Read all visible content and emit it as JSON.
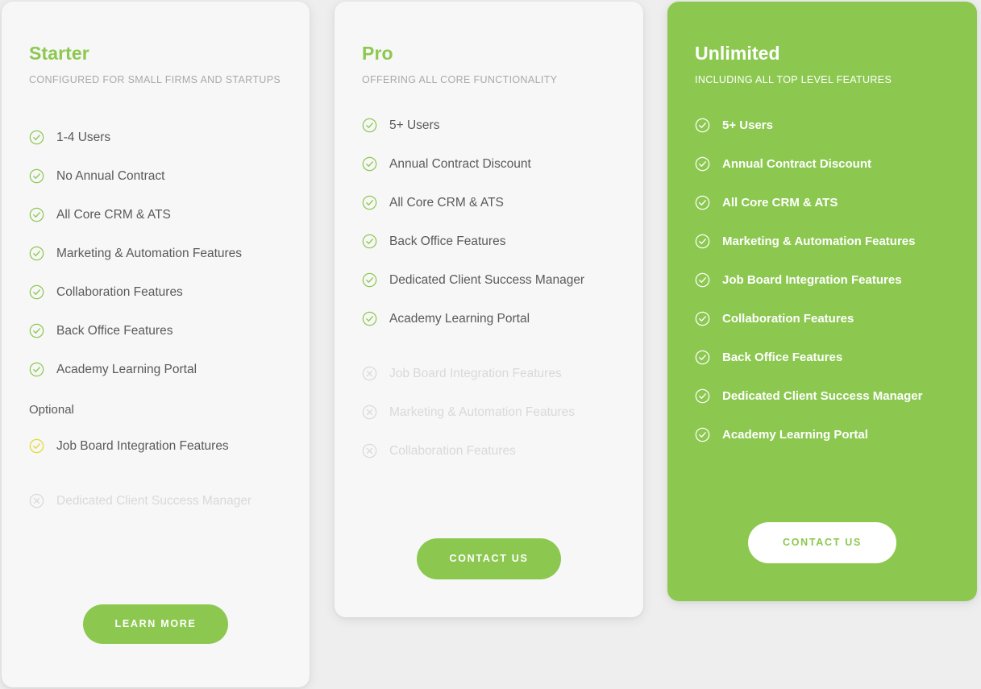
{
  "theme": {
    "page_background": "#eeeeee",
    "card_background": "#f7f7f7",
    "accent_green": "#8cc850",
    "optional_yellow": "#e3dc3c",
    "disabled_gray": "#d9d9d9",
    "text_gray": "#5a5a5a",
    "subtitle_gray": "#a9a9a9"
  },
  "plans": [
    {
      "id": "starter",
      "title": "Starter",
      "subtitle": "CONFIGURED FOR SMALL FIRMS AND STARTUPS",
      "features": [
        {
          "label": "1-4 Users",
          "state": "included",
          "icon": "check-circle-icon"
        },
        {
          "label": "No Annual Contract",
          "state": "included",
          "icon": "check-circle-icon"
        },
        {
          "label": "All Core CRM & ATS",
          "state": "included",
          "icon": "check-circle-icon"
        },
        {
          "label": "Marketing & Automation Features",
          "state": "included",
          "icon": "check-circle-icon"
        },
        {
          "label": "Collaboration Features",
          "state": "included",
          "icon": "check-circle-icon"
        },
        {
          "label": "Back Office Features",
          "state": "included",
          "icon": "check-circle-icon"
        },
        {
          "label": "Academy Learning Portal",
          "state": "included",
          "icon": "check-circle-icon"
        }
      ],
      "optional_heading": "Optional",
      "optional_features": [
        {
          "label": "Job Board Integration Features",
          "state": "optional",
          "icon": "check-circle-icon"
        }
      ],
      "excluded_features": [
        {
          "label": "Dedicated Client Success Manager",
          "state": "excluded",
          "icon": "x-circle-icon"
        }
      ],
      "cta_label": "Learn More",
      "cta_style": "solid"
    },
    {
      "id": "pro",
      "title": "Pro",
      "subtitle": "OFFERING ALL CORE FUNCTIONALITY",
      "features": [
        {
          "label": "5+ Users",
          "state": "included",
          "icon": "check-circle-icon"
        },
        {
          "label": "Annual Contract Discount",
          "state": "included",
          "icon": "check-circle-icon"
        },
        {
          "label": "All Core CRM & ATS",
          "state": "included",
          "icon": "check-circle-icon"
        },
        {
          "label": "Back Office Features",
          "state": "included",
          "icon": "check-circle-icon"
        },
        {
          "label": "Dedicated Client Success Manager",
          "state": "included",
          "icon": "check-circle-icon"
        },
        {
          "label": "Academy Learning Portal",
          "state": "included",
          "icon": "check-circle-icon"
        }
      ],
      "optional_heading": "",
      "optional_features": [],
      "excluded_features": [
        {
          "label": "Job Board Integration Features",
          "state": "excluded",
          "icon": "x-circle-icon"
        },
        {
          "label": "Marketing & Automation Features",
          "state": "excluded",
          "icon": "x-circle-icon"
        },
        {
          "label": "Collaboration Features",
          "state": "excluded",
          "icon": "x-circle-icon"
        }
      ],
      "cta_label": "Contact Us",
      "cta_style": "solid"
    },
    {
      "id": "unlimited",
      "title": "Unlimited",
      "subtitle": "INCLUDING ALL TOP LEVEL FEATURES",
      "features": [
        {
          "label": "5+ Users",
          "state": "included",
          "icon": "check-circle-icon"
        },
        {
          "label": "Annual Contract Discount",
          "state": "included",
          "icon": "check-circle-icon"
        },
        {
          "label": "All Core CRM & ATS",
          "state": "included",
          "icon": "check-circle-icon"
        },
        {
          "label": "Marketing & Automation Features",
          "state": "included",
          "icon": "check-circle-icon"
        },
        {
          "label": "Job Board Integration Features",
          "state": "included",
          "icon": "check-circle-icon"
        },
        {
          "label": "Collaboration Features",
          "state": "included",
          "icon": "check-circle-icon"
        },
        {
          "label": "Back Office Features",
          "state": "included",
          "icon": "check-circle-icon"
        },
        {
          "label": "Dedicated Client Success Manager",
          "state": "included",
          "icon": "check-circle-icon"
        },
        {
          "label": "Academy Learning Portal",
          "state": "included",
          "icon": "check-circle-icon"
        }
      ],
      "optional_heading": "",
      "optional_features": [],
      "excluded_features": [],
      "cta_label": "Contact Us",
      "cta_style": "ghost"
    }
  ]
}
